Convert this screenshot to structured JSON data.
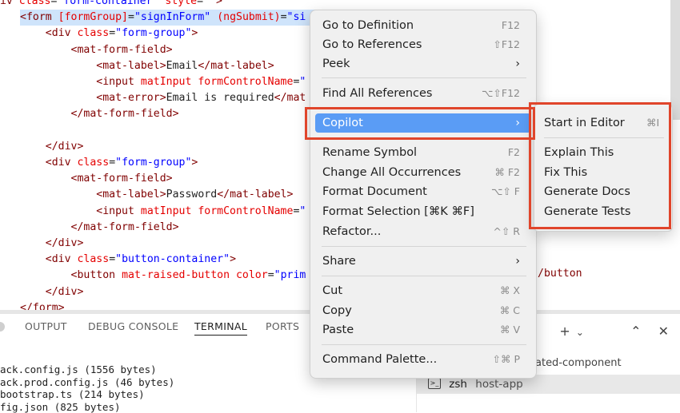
{
  "editor": {
    "lines": [
      [
        {
          "c": "tag",
          "t": "div "
        },
        {
          "c": "attr",
          "t": "class"
        },
        {
          "c": "txt",
          "t": "="
        },
        {
          "c": "str",
          "t": "\"form-container\""
        },
        {
          "c": "txt",
          "t": " "
        },
        {
          "c": "attr",
          "t": "style"
        },
        {
          "c": "txt",
          "t": "="
        },
        {
          "c": "str",
          "t": "\"\""
        },
        {
          "c": "punc",
          "t": ">"
        }
      ],
      [
        {
          "c": "punc",
          "t": "<"
        },
        {
          "c": "tag",
          "t": "form "
        },
        {
          "c": "attr",
          "t": "[formGroup]"
        },
        {
          "c": "txt",
          "t": "="
        },
        {
          "c": "str",
          "t": "\"signInForm\""
        },
        {
          "c": "txt",
          "t": " "
        },
        {
          "c": "attr",
          "t": "(ngSubmit)"
        },
        {
          "c": "txt",
          "t": "="
        },
        {
          "c": "str",
          "t": "\"si"
        }
      ],
      [
        {
          "c": "txt",
          "t": "    "
        },
        {
          "c": "punc",
          "t": "<"
        },
        {
          "c": "tag",
          "t": "div "
        },
        {
          "c": "attr",
          "t": "class"
        },
        {
          "c": "txt",
          "t": "="
        },
        {
          "c": "str",
          "t": "\"form-group\""
        },
        {
          "c": "punc",
          "t": ">"
        }
      ],
      [
        {
          "c": "txt",
          "t": "        "
        },
        {
          "c": "punc",
          "t": "<"
        },
        {
          "c": "tag",
          "t": "mat-form-field"
        },
        {
          "c": "punc",
          "t": ">"
        }
      ],
      [
        {
          "c": "txt",
          "t": "            "
        },
        {
          "c": "punc",
          "t": "<"
        },
        {
          "c": "tag",
          "t": "mat-label"
        },
        {
          "c": "punc",
          "t": ">"
        },
        {
          "c": "txt",
          "t": "Email"
        },
        {
          "c": "punc",
          "t": "</"
        },
        {
          "c": "tag",
          "t": "mat-label"
        },
        {
          "c": "punc",
          "t": ">"
        }
      ],
      [
        {
          "c": "txt",
          "t": "            "
        },
        {
          "c": "punc",
          "t": "<"
        },
        {
          "c": "tag",
          "t": "input "
        },
        {
          "c": "attr",
          "t": "matInput formControlName"
        },
        {
          "c": "txt",
          "t": "="
        },
        {
          "c": "str",
          "t": "\""
        }
      ],
      [
        {
          "c": "txt",
          "t": "            "
        },
        {
          "c": "punc",
          "t": "<"
        },
        {
          "c": "tag",
          "t": "mat-error"
        },
        {
          "c": "punc",
          "t": ">"
        },
        {
          "c": "txt",
          "t": "Email is required"
        },
        {
          "c": "punc",
          "t": "</"
        },
        {
          "c": "tag",
          "t": "mat"
        }
      ],
      [
        {
          "c": "txt",
          "t": "        "
        },
        {
          "c": "punc",
          "t": "</"
        },
        {
          "c": "tag",
          "t": "mat-form-field"
        },
        {
          "c": "punc",
          "t": ">"
        }
      ],
      [],
      [
        {
          "c": "txt",
          "t": "    "
        },
        {
          "c": "punc",
          "t": "</"
        },
        {
          "c": "tag",
          "t": "div"
        },
        {
          "c": "punc",
          "t": ">"
        }
      ],
      [
        {
          "c": "txt",
          "t": "    "
        },
        {
          "c": "punc",
          "t": "<"
        },
        {
          "c": "tag",
          "t": "div "
        },
        {
          "c": "attr",
          "t": "class"
        },
        {
          "c": "txt",
          "t": "="
        },
        {
          "c": "str",
          "t": "\"form-group\""
        },
        {
          "c": "punc",
          "t": ">"
        }
      ],
      [
        {
          "c": "txt",
          "t": "        "
        },
        {
          "c": "punc",
          "t": "<"
        },
        {
          "c": "tag",
          "t": "mat-form-field"
        },
        {
          "c": "punc",
          "t": ">"
        }
      ],
      [
        {
          "c": "txt",
          "t": "            "
        },
        {
          "c": "punc",
          "t": "<"
        },
        {
          "c": "tag",
          "t": "mat-label"
        },
        {
          "c": "punc",
          "t": ">"
        },
        {
          "c": "txt",
          "t": "Password"
        },
        {
          "c": "punc",
          "t": "</"
        },
        {
          "c": "tag",
          "t": "mat-label"
        },
        {
          "c": "punc",
          "t": ">"
        }
      ],
      [
        {
          "c": "txt",
          "t": "            "
        },
        {
          "c": "punc",
          "t": "<"
        },
        {
          "c": "tag",
          "t": "input "
        },
        {
          "c": "attr",
          "t": "matInput formControlName"
        },
        {
          "c": "txt",
          "t": "="
        },
        {
          "c": "str",
          "t": "\""
        }
      ],
      [
        {
          "c": "txt",
          "t": "        "
        },
        {
          "c": "punc",
          "t": "</"
        },
        {
          "c": "tag",
          "t": "mat-form-field"
        },
        {
          "c": "punc",
          "t": ">"
        }
      ],
      [
        {
          "c": "txt",
          "t": "    "
        },
        {
          "c": "punc",
          "t": "</"
        },
        {
          "c": "tag",
          "t": "div"
        },
        {
          "c": "punc",
          "t": ">"
        }
      ],
      [
        {
          "c": "txt",
          "t": "    "
        },
        {
          "c": "punc",
          "t": "<"
        },
        {
          "c": "tag",
          "t": "div "
        },
        {
          "c": "attr",
          "t": "class"
        },
        {
          "c": "txt",
          "t": "="
        },
        {
          "c": "str",
          "t": "\"button-container\""
        },
        {
          "c": "punc",
          "t": ">"
        }
      ],
      [
        {
          "c": "txt",
          "t": "        "
        },
        {
          "c": "punc",
          "t": "<"
        },
        {
          "c": "tag",
          "t": "button "
        },
        {
          "c": "attr",
          "t": "mat-raised-button color"
        },
        {
          "c": "txt",
          "t": "="
        },
        {
          "c": "str",
          "t": "\"prim"
        }
      ],
      [
        {
          "c": "txt",
          "t": "    "
        },
        {
          "c": "punc",
          "t": "</"
        },
        {
          "c": "tag",
          "t": "div"
        },
        {
          "c": "punc",
          "t": ">"
        }
      ],
      [
        {
          "c": "punc",
          "t": "</"
        },
        {
          "c": "tag",
          "t": "form"
        },
        {
          "c": "punc",
          "t": ">"
        }
      ]
    ],
    "behind_menu_fragment": "/button"
  },
  "panel": {
    "tabs": [
      "OUTPUT",
      "DEBUG CONSOLE",
      "TERMINAL",
      "PORTS"
    ],
    "active_tab": "TERMINAL",
    "terminal_lines": [
      "ack.config.js (1556 bytes)",
      "ack.prod.config.js (46 bytes)",
      "bootstrap.ts (214 bytes)",
      "fig.json (825 bytes)"
    ],
    "terminal_list": {
      "row1": "ated-component",
      "row2_shell": "zsh",
      "row2_name": "host-app"
    },
    "actions": [
      "+",
      "⌄",
      "…",
      "⌃",
      "✕"
    ]
  },
  "menu": {
    "items": [
      {
        "label": "Go to Definition",
        "shortcut": "F12"
      },
      {
        "label": "Go to References",
        "shortcut": "⇧F12"
      },
      {
        "label": "Peek",
        "shortcut": "›"
      },
      {
        "label": "Find All References",
        "shortcut": "⌥⇧F12"
      },
      {
        "label": "Copilot",
        "shortcut": "›"
      },
      {
        "label": "Rename Symbol",
        "shortcut": "F2"
      },
      {
        "label": "Change All Occurrences",
        "shortcut": "⌘ F2"
      },
      {
        "label": "Format Document",
        "shortcut": "⌥⇧ F"
      },
      {
        "label": "Format Selection [⌘K ⌘F]",
        "shortcut": ""
      },
      {
        "label": "Refactor...",
        "shortcut": "^⇧ R"
      },
      {
        "label": "Share",
        "shortcut": "›"
      },
      {
        "label": "Cut",
        "shortcut": "⌘ X"
      },
      {
        "label": "Copy",
        "shortcut": "⌘ C"
      },
      {
        "label": "Paste",
        "shortcut": "⌘ V"
      },
      {
        "label": "Command Palette...",
        "shortcut": "⇧⌘ P"
      }
    ]
  },
  "submenu": {
    "items": [
      {
        "label": "Start in Editor",
        "shortcut": "⌘I"
      },
      {
        "label": "Explain This",
        "shortcut": ""
      },
      {
        "label": "Fix This",
        "shortcut": ""
      },
      {
        "label": "Generate Docs",
        "shortcut": ""
      },
      {
        "label": "Generate Tests",
        "shortcut": ""
      }
    ]
  },
  "colors": {
    "highlight": "#e0452b",
    "menu_active": "#5a9cf5",
    "selection": "#cfe4fb"
  }
}
